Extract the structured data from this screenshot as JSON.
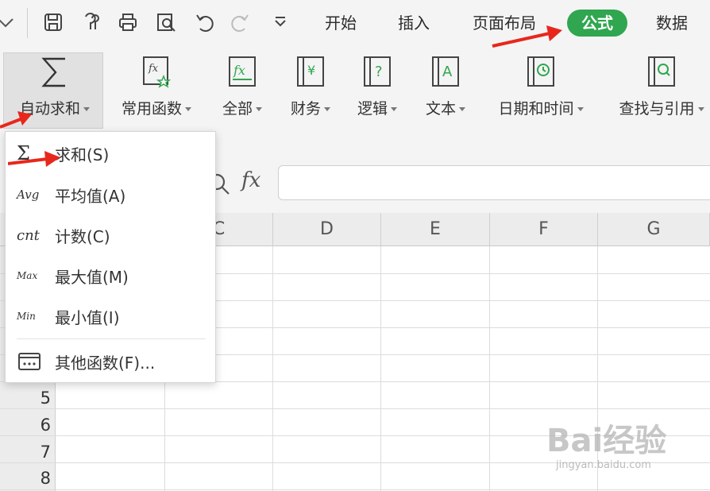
{
  "ribbon_tabs": [
    {
      "label": "开始",
      "active": false
    },
    {
      "label": "插入",
      "active": false
    },
    {
      "label": "页面布局",
      "active": false
    },
    {
      "label": "公式",
      "active": true
    },
    {
      "label": "数据",
      "active": false
    }
  ],
  "quick_access": [
    "chevron-down-icon",
    "save-icon",
    "format-painter-icon",
    "print-icon",
    "print-preview-icon",
    "undo-icon",
    "redo-icon",
    "customize-dropdown-icon"
  ],
  "ribbon_buttons": [
    {
      "label": "自动求和",
      "icon": "sigma-icon"
    },
    {
      "label": "常用函数",
      "icon": "fx-star-icon"
    },
    {
      "label": "全部",
      "icon": "fx-all-icon"
    },
    {
      "label": "财务",
      "icon": "finance-yen-icon"
    },
    {
      "label": "逻辑",
      "icon": "logic-question-icon"
    },
    {
      "label": "文本",
      "icon": "text-a-icon"
    },
    {
      "label": "日期和时间",
      "icon": "clock-icon"
    },
    {
      "label": "查找与引用",
      "icon": "search-reference-icon"
    }
  ],
  "formula_bar": {
    "fx_label": "fx",
    "value": ""
  },
  "columns": [
    "C",
    "D",
    "E",
    "F",
    "G"
  ],
  "rows": [
    "5",
    "6",
    "7",
    "8"
  ],
  "autosum_menu": {
    "items": [
      {
        "icon_text": "Σ",
        "label": "求和(S)"
      },
      {
        "icon_text": "Avg",
        "label": "平均值(A)"
      },
      {
        "icon_text": "cnt",
        "label": "计数(C)"
      },
      {
        "icon_text": "Max",
        "label": "最大值(M)"
      },
      {
        "icon_text": "Min",
        "label": "最小值(I)"
      },
      {
        "icon_text": "",
        "label": "其他函数(F)..."
      }
    ]
  },
  "watermark": {
    "text": "Bai经验",
    "sub": "jingyan.baidu.com"
  },
  "colors": {
    "accent": "#2fa64f",
    "arrow": "#e8271c",
    "chrome": "#f4f4f4"
  }
}
